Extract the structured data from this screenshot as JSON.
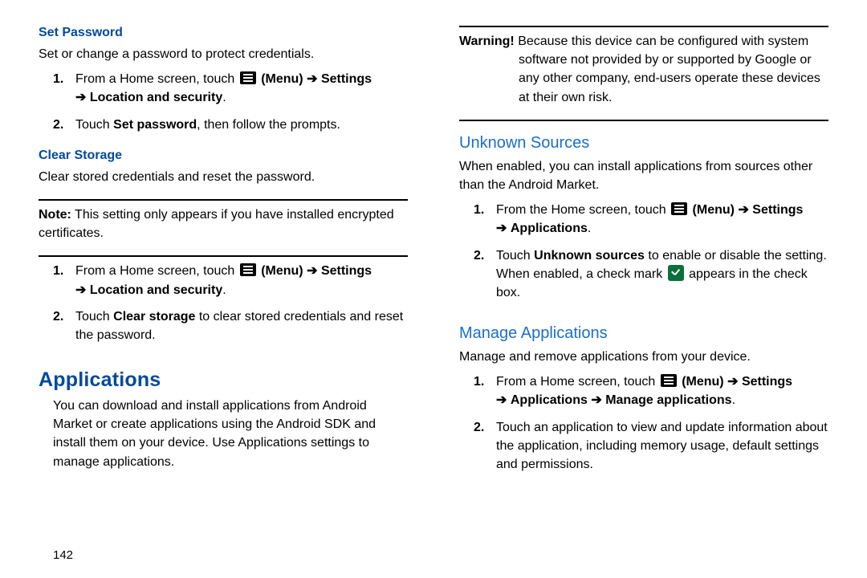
{
  "setPassword": {
    "heading": "Set Password",
    "desc": "Set or change a password to protect credentials.",
    "step1_pre": "From a Home screen, touch ",
    "step1_menu": "(Menu)",
    "step1_settings": "Settings",
    "step1_line2_location": "Location and security",
    "step2_pre": "Touch ",
    "step2_bold": "Set password",
    "step2_post": ", then follow the prompts."
  },
  "clearStorage": {
    "heading": "Clear Storage",
    "desc": "Clear stored credentials and reset the password.",
    "note_label": "Note:",
    "note_body": "This setting only appears if you have installed encrypted certificates.",
    "step1_pre": "From a Home screen, touch ",
    "step1_menu": "(Menu)",
    "step1_settings": "Settings",
    "step1_line2_location": "Location and security",
    "step2_pre": "Touch ",
    "step2_bold": "Clear storage",
    "step2_post": " to clear stored credentials and reset the password."
  },
  "applications": {
    "heading": "Applications",
    "intro": "You can download and install applications from Android Market or create applications using the Android SDK and install them on your device. Use Applications settings to manage applications."
  },
  "warning": {
    "label": "Warning!",
    "body": "Because this device can be configured with system software not provided by or supported by Google or any other company, end-users operate these devices at their own risk."
  },
  "unknownSources": {
    "heading": "Unknown Sources",
    "desc": "When enabled, you can install applications from sources other than the Android Market.",
    "step1_pre": "From the Home screen, touch ",
    "step1_menu": "(Menu)",
    "step1_settings": "Settings",
    "step1_line2_apps": "Applications",
    "step2_pre": "Touch ",
    "step2_bold": "Unknown sources",
    "step2_mid": " to enable or disable the setting. When enabled, a check mark ",
    "step2_post": " appears in the check box."
  },
  "manageApps": {
    "heading": "Manage Applications",
    "desc": "Manage and remove applications from your device.",
    "step1_pre": "From a Home screen, touch ",
    "step1_menu": "(Menu)",
    "step1_settings": "Settings",
    "step1_line2_apps": "Applications",
    "step1_line2_manage": "Manage applications",
    "step2": "Touch an application to view and update information about the application, including memory usage, default settings and permissions."
  },
  "arrow": "➔",
  "pageNumber": "142"
}
